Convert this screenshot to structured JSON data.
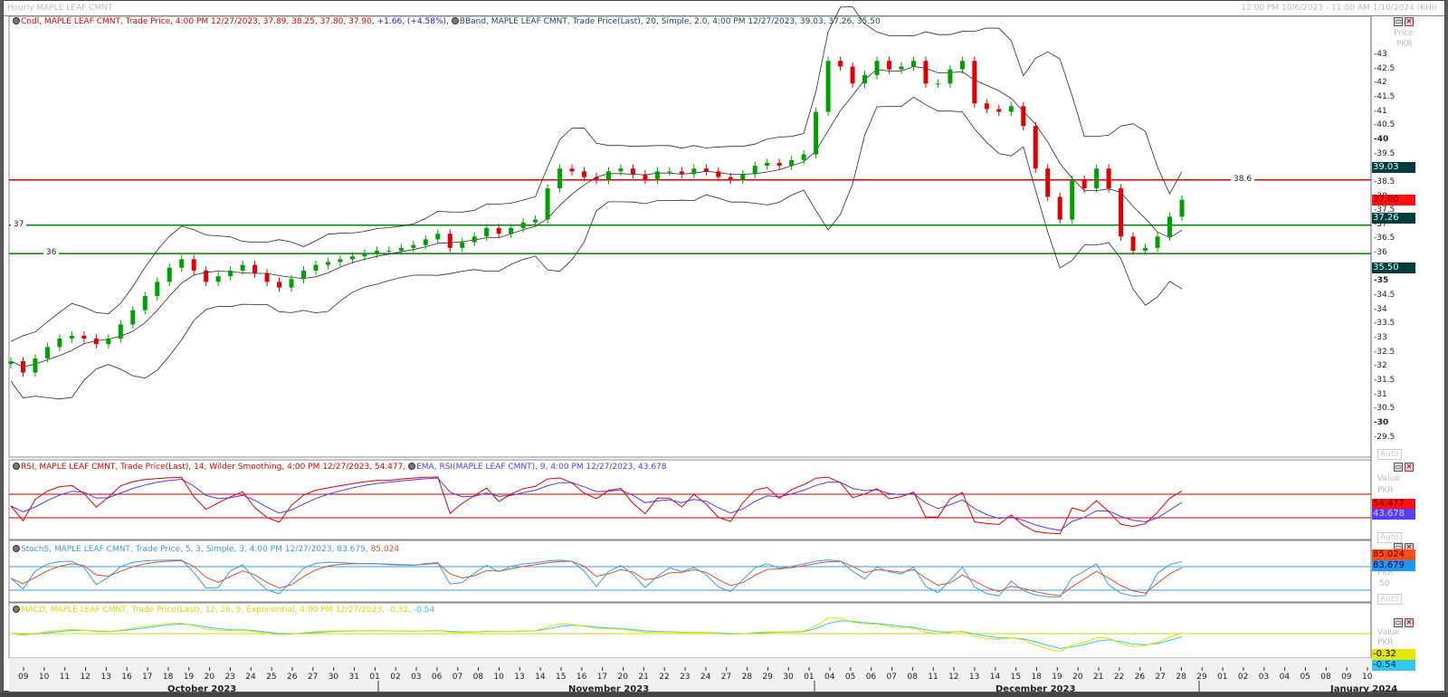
{
  "window": {
    "title": "Hourly MAPLE LEAF CMNT",
    "range": "12:00 PM 10/6/2023 - 11:00 AM 1/10/2024 (KHI)"
  },
  "colors": {
    "up": "#00a000",
    "down": "#e00000",
    "bands": "#2a2a2a",
    "rsi": "#e00000",
    "ema": "#4a3cff",
    "stoch_k": "#3a9ce8",
    "stoch_d": "#e0502a",
    "macd": "#e0e000",
    "signal": "#30c8f0",
    "line_red": "#e00000",
    "line_green": "#008000",
    "badge_dark": "#003c3c"
  },
  "price_panel": {
    "header_candle": "Cndl, MAPLE LEAF CMNT, Trade Price,  4:00 PM 12/27/2023, 37.89, 38.25, 37.80, 37.90,",
    "header_change": "+1.66, (+4.58%),",
    "header_bband": "BBand, MAPLE LEAF CMNT, Trade Price(Last),  20, Simple, 2.0,  4:00 PM 12/27/2023, 39.03, 37.26, 35.50",
    "axis_title": "Price",
    "axis_unit": "PKR",
    "auto": "Auto",
    "badges": [
      {
        "value": "39.03",
        "price": 39.03,
        "bg": "#003c3c",
        "fg": "#cfe"
      },
      {
        "value": "37.90",
        "price": 37.9,
        "bg": "#ff1010",
        "fg": "#700"
      },
      {
        "value": "37.26",
        "price": 37.26,
        "bg": "#003c3c",
        "fg": "#cfe"
      },
      {
        "value": "35.50",
        "price": 35.5,
        "bg": "#003c3c",
        "fg": "#cfe"
      }
    ],
    "hlines": [
      {
        "price": 38.6,
        "label": "38.6",
        "color": "#e00000"
      },
      {
        "price": 37,
        "label": "37",
        "color": "#008000"
      },
      {
        "price": 36,
        "label": "36",
        "color": "#008000"
      }
    ]
  },
  "rsi_panel": {
    "header_rsi": "RSI, MAPLE LEAF CMNT, Trade Price(Last),  14, Wilder Smoothing,  4:00 PM 12/27/2023, 54.477,",
    "header_ema": "EMA, RSI(MAPLE LEAF CMNT),  9,  4:00 PM 12/27/2023, 43.678",
    "axis_title": "Value",
    "axis_unit": "PKR",
    "auto": "Auto",
    "badges": [
      {
        "value": "54.477",
        "bg": "#ff1010",
        "fg": "#600"
      },
      {
        "value": "43.678",
        "bg": "#5a3cff",
        "fg": "#ccd"
      }
    ]
  },
  "stoch_panel": {
    "header": "StochS, MAPLE LEAF CMNT, Trade Price,  5, 3, Simple, 3,  4:00 PM 12/27/2023, 83.679,",
    "header_d": "85.024",
    "axis_unit": "PKR",
    "axis_mid": "50",
    "auto": "Auto",
    "badges": [
      {
        "value": "85.024",
        "bg": "#ff4a1a",
        "fg": "#600"
      },
      {
        "value": "83.679",
        "bg": "#1e96ff",
        "fg": "#001"
      }
    ]
  },
  "macd_panel": {
    "header": "MACD, MAPLE LEAF CMNT, Trade Price(Last),  12, 26, 9, Exponential,  4:00 PM 12/27/2023, -0.32,",
    "header_signal": "-0.54",
    "axis_title": "Value",
    "axis_unit": "PKR",
    "badges": [
      {
        "value": "-0.32",
        "bg": "#e6e600",
        "fg": "#000"
      },
      {
        "value": "-0.54",
        "bg": "#30c8f0",
        "fg": "#024"
      }
    ]
  },
  "chart_data": {
    "type": "candlestick",
    "ylim": [
      29.5,
      43.5
    ],
    "y_ticks": [
      "43",
      "42.5",
      "42",
      "41.5",
      "41",
      "40.5",
      "40",
      "39.5",
      "39",
      "38.5",
      "38",
      "37.5",
      "37",
      "36.5",
      "36",
      "35.5",
      "35",
      "34.5",
      "34",
      "33.5",
      "33",
      "32.5",
      "32",
      "31.5",
      "31",
      "30.5",
      "30",
      "29.5"
    ],
    "closes": [
      32.2,
      31.8,
      32.3,
      32.7,
      33.0,
      33.1,
      33.0,
      32.8,
      33.0,
      33.5,
      34.0,
      34.5,
      35.0,
      35.5,
      35.8,
      35.4,
      35.0,
      35.2,
      35.4,
      35.6,
      35.3,
      35.0,
      34.8,
      35.1,
      35.4,
      35.6,
      35.7,
      35.8,
      35.9,
      36.0,
      36.1,
      36.1,
      36.2,
      36.3,
      36.5,
      36.7,
      36.2,
      36.4,
      36.6,
      36.9,
      36.7,
      36.9,
      37.1,
      37.2,
      38.3,
      39.0,
      38.9,
      38.7,
      38.6,
      38.9,
      39.0,
      38.8,
      38.6,
      38.9,
      38.9,
      38.8,
      39.0,
      38.9,
      38.7,
      38.6,
      38.8,
      39.1,
      39.2,
      39.1,
      39.3,
      39.5,
      41.0,
      42.8,
      42.6,
      42.0,
      42.3,
      42.8,
      42.5,
      42.6,
      42.8,
      42.0,
      42.0,
      42.5,
      42.8,
      41.3,
      41.1,
      41.0,
      41.2,
      40.5,
      39.0,
      38.0,
      37.2,
      38.6,
      38.3,
      39.0,
      38.3,
      36.6,
      36.1,
      36.2,
      36.6,
      37.3,
      37.9
    ],
    "x_ticks": [
      "09",
      "10",
      "11",
      "12",
      "13",
      "16",
      "17",
      "18",
      "19",
      "20",
      "23",
      "24",
      "25",
      "26",
      "27",
      "30",
      "31",
      "01",
      "02",
      "03",
      "06",
      "07",
      "08",
      "10",
      "13",
      "14",
      "15",
      "16",
      "17",
      "20",
      "21",
      "22",
      "23",
      "24",
      "27",
      "28",
      "29",
      "30",
      "01",
      "04",
      "05",
      "06",
      "07",
      "08",
      "11",
      "12",
      "13",
      "14",
      "15",
      "18",
      "19",
      "20",
      "21",
      "22",
      "26",
      "27",
      "28",
      "29",
      "01",
      "02",
      "03",
      "04",
      "05",
      "08",
      "09",
      "10"
    ],
    "months": [
      "October 2023",
      "November 2023",
      "December 2023",
      "January 2024"
    ]
  }
}
